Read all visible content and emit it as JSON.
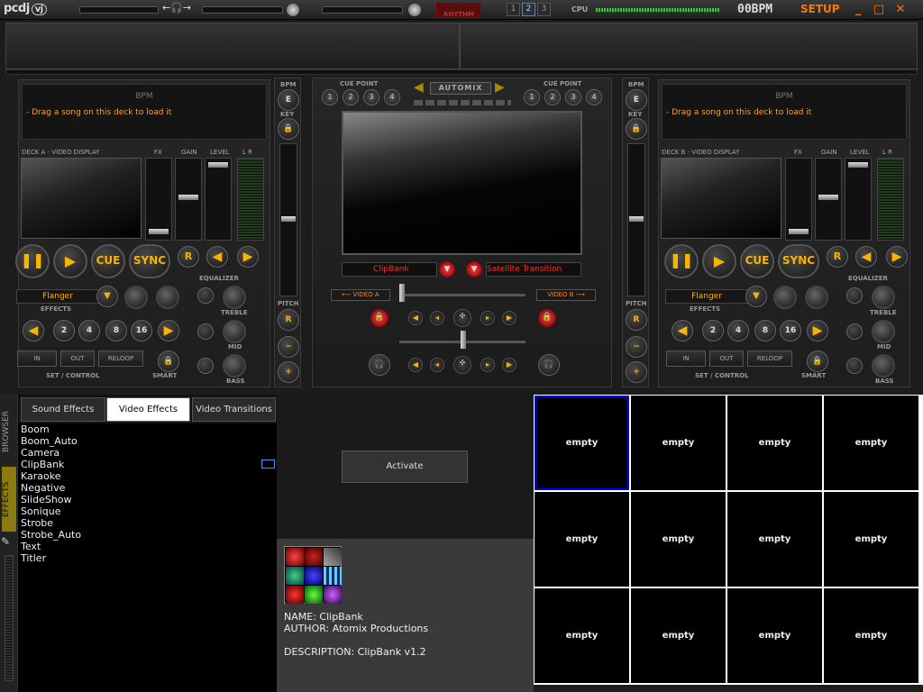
{
  "app": {
    "logo": "pcdj",
    "logo_badge": "vj",
    "rhythm_label": "RHYTHM",
    "deck_numbers": [
      "1",
      "2",
      "3"
    ],
    "cpu_label": "CPU",
    "bpm_readout": "00BPM",
    "setup_label": "SETUP",
    "window_buttons": [
      "_",
      "□",
      "✕"
    ]
  },
  "deck_a": {
    "bpm_label": "BPM",
    "message": "- Drag a song on this deck to load it",
    "video_label": "DECK A - VIDEO DISPLAY",
    "fx_label": "FX",
    "gain_label": "GAIN",
    "level_label": "LEVEL",
    "lr_label": "L  R",
    "cue_label": "CUE",
    "sync_label": "SYNC",
    "r_label": "R",
    "equalizer_label": "EQUALIZER",
    "effect": "Flanger",
    "effects_label": "EFFECTS",
    "treble_label": "TREBLE",
    "mid_label": "MID",
    "bass_label": "BASS",
    "loop_sizes": [
      "2",
      "4",
      "8",
      "16"
    ],
    "in_label": "IN",
    "out_label": "OUT",
    "reloop_label": "RELOOP",
    "set_control_label": "SET / CONTROL",
    "smart_label": "SMART"
  },
  "deck_b": {
    "bpm_label": "BPM",
    "message": "- Drag a song on this deck to load it",
    "video_label": "DECK B - VIDEO DISPLAY",
    "fx_label": "FX",
    "gain_label": "GAIN",
    "level_label": "LEVEL",
    "lr_label": "L  R",
    "cue_label": "CUE",
    "sync_label": "SYNC",
    "r_label": "R",
    "equalizer_label": "EQUALIZER",
    "effect": "Flanger",
    "effects_label": "EFFECTS",
    "treble_label": "TREBLE",
    "mid_label": "MID",
    "bass_label": "BASS",
    "loop_sizes": [
      "2",
      "4",
      "8",
      "16"
    ],
    "in_label": "IN",
    "out_label": "OUT",
    "reloop_label": "RELOOP",
    "set_control_label": "SET / CONTROL",
    "smart_label": "SMART"
  },
  "pitch": {
    "bpm": "BPM",
    "key": "KEY",
    "pitch": "PITCH",
    "e": "E",
    "r": "R",
    "minus": "−",
    "plus": "+"
  },
  "mixer": {
    "cue_point_label": "CUE POINT",
    "cue_points": [
      "1",
      "2",
      "3",
      "4"
    ],
    "automix_label": "AUTOMIX",
    "clipbank_select": "ClipBank",
    "transition_select": "Satellite Transition",
    "video_a_label": "VIDEO A",
    "video_b_label": "VIDEO B"
  },
  "browser": {
    "side_tabs": [
      "BROWSER",
      "EFFECTS"
    ],
    "tabs": [
      "Sound Effects",
      "Video Effects",
      "Video Transitions"
    ],
    "effects": [
      "Boom",
      "Boom_Auto",
      "Camera",
      "ClipBank",
      "Karaoke",
      "Negative",
      "SlideShow",
      "Sonique",
      "Strobe",
      "Strobe_Auto",
      "Text",
      "Titler"
    ],
    "activate_label": "Activate",
    "info": {
      "name": "NAME: ClipBank",
      "author": "AUTHOR: Atomix Productions",
      "description": "DESCRIPTION: ClipBank v1.2"
    },
    "clips": [
      "empty",
      "empty",
      "empty",
      "empty",
      "empty",
      "empty",
      "empty",
      "empty",
      "empty",
      "empty",
      "empty",
      "empty"
    ]
  },
  "colors": {
    "accent": "#f7b400",
    "setup": "#ff7700",
    "message": "#f7a23a",
    "selected_clip_border": "#0000ff"
  }
}
